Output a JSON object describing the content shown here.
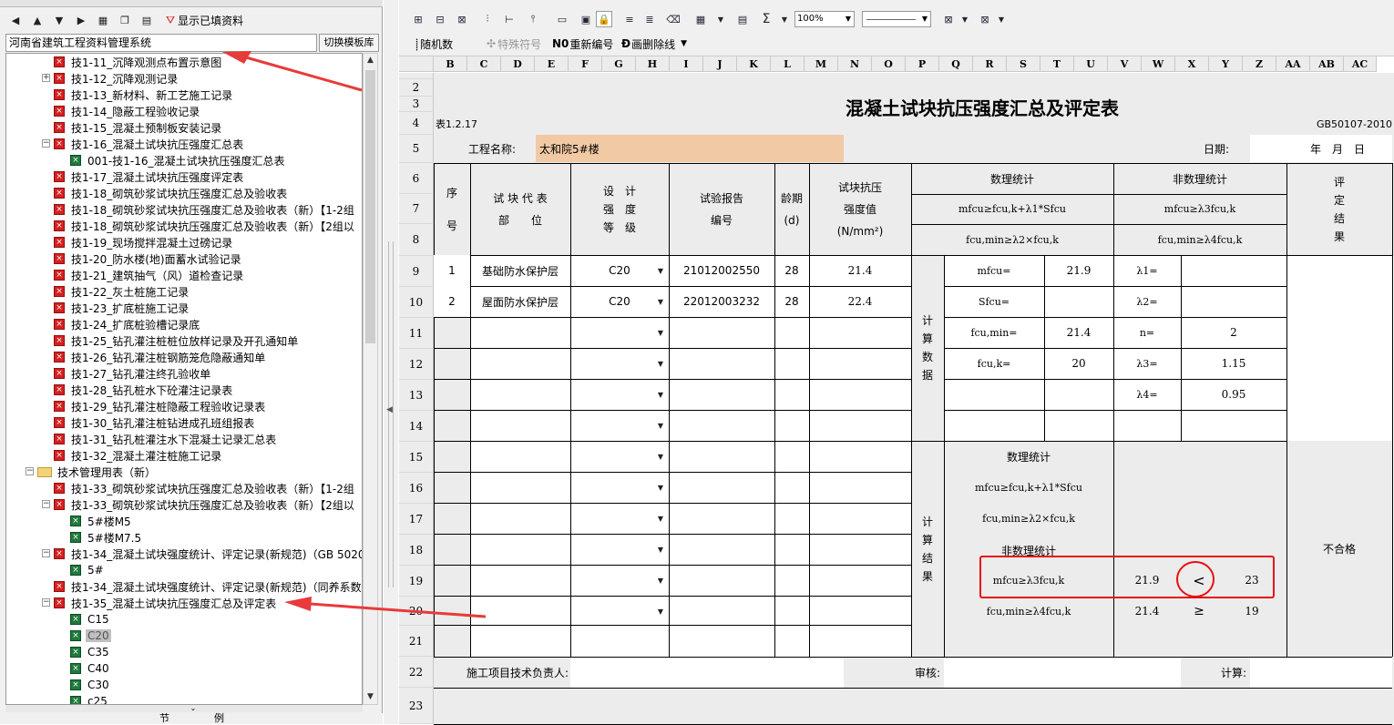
{
  "left_panel": {
    "toolbar": {
      "show_filled": "显示已填资料"
    },
    "project": "河南省建筑工程资料管理系统",
    "switch_template": "切换模板库",
    "tree": [
      {
        "label": "技1-11_沉降观测点布置示意图",
        "icon": "red",
        "level": 3,
        "exp": ""
      },
      {
        "label": "技1-12_沉降观测记录",
        "icon": "red",
        "level": 3,
        "exp": "+"
      },
      {
        "label": "技1-13_新材料、新工艺施工记录",
        "icon": "red",
        "level": 3,
        "exp": ""
      },
      {
        "label": "技1-14_隐蔽工程验收记录",
        "icon": "red",
        "level": 3,
        "exp": ""
      },
      {
        "label": "技1-15_混凝土预制板安装记录",
        "icon": "red",
        "level": 3,
        "exp": ""
      },
      {
        "label": "技1-16_混凝土试块抗压强度汇总表",
        "icon": "red",
        "level": 3,
        "exp": "-"
      },
      {
        "label": "001-技1-16_混凝土试块抗压强度汇总表",
        "icon": "green",
        "level": 4,
        "exp": ""
      },
      {
        "label": "技1-17_混凝土试块抗压强度评定表",
        "icon": "red",
        "level": 3,
        "exp": ""
      },
      {
        "label": "技1-18_砌筑砂浆试块抗压强度汇总及验收表",
        "icon": "red",
        "level": 3,
        "exp": ""
      },
      {
        "label": "技1-18_砌筑砂浆试块抗压强度汇总及验收表（新）【1-2组",
        "icon": "red",
        "level": 3,
        "exp": ""
      },
      {
        "label": "技1-18_砌筑砂浆试块抗压强度汇总及验收表（新）【2组以",
        "icon": "red",
        "level": 3,
        "exp": ""
      },
      {
        "label": "技1-19_现场搅拌混凝土过磅记录",
        "icon": "red",
        "level": 3,
        "exp": ""
      },
      {
        "label": "技1-20_防水楼(地)面蓄水试验记录",
        "icon": "red",
        "level": 3,
        "exp": ""
      },
      {
        "label": "技1-21_建筑抽气（风）道检查记录",
        "icon": "red",
        "level": 3,
        "exp": ""
      },
      {
        "label": "技1-22_灰土桩施工记录",
        "icon": "red",
        "level": 3,
        "exp": ""
      },
      {
        "label": "技1-23_扩底桩施工记录",
        "icon": "red",
        "level": 3,
        "exp": ""
      },
      {
        "label": "技1-24_扩底桩验槽记录底",
        "icon": "red",
        "level": 3,
        "exp": ""
      },
      {
        "label": "技1-25_钻孔灌注桩桩位放样记录及开孔通知单",
        "icon": "red",
        "level": 3,
        "exp": ""
      },
      {
        "label": "技1-26_钻孔灌注桩钢筋笼危隐蔽通知单",
        "icon": "red",
        "level": 3,
        "exp": ""
      },
      {
        "label": "技1-27_钻孔灌注终孔验收单",
        "icon": "red",
        "level": 3,
        "exp": ""
      },
      {
        "label": "技1-28_钻孔桩水下砼灌注记录表",
        "icon": "red",
        "level": 3,
        "exp": ""
      },
      {
        "label": "技1-29_钻孔灌注桩隐蔽工程验收记录表",
        "icon": "red",
        "level": 3,
        "exp": ""
      },
      {
        "label": "技1-30_钻孔灌注桩钻进成孔班组报表",
        "icon": "red",
        "level": 3,
        "exp": ""
      },
      {
        "label": "技1-31_钻孔桩灌注水下混凝土记录汇总表",
        "icon": "red",
        "level": 3,
        "exp": ""
      },
      {
        "label": "技1-32_混凝土灌注桩施工记录",
        "icon": "red",
        "level": 3,
        "exp": ""
      },
      {
        "label": "技术管理用表（新）",
        "icon": "folder",
        "level": 2,
        "exp": "-"
      },
      {
        "label": "技1-33_砌筑砂浆试块抗压强度汇总及验收表（新）【1-2组",
        "icon": "red",
        "level": 3,
        "exp": ""
      },
      {
        "label": "技1-33_砌筑砂浆试块抗压强度汇总及验收表（新）【2组以",
        "icon": "red",
        "level": 3,
        "exp": "-"
      },
      {
        "label": "5#楼M5",
        "icon": "green",
        "level": 4,
        "exp": ""
      },
      {
        "label": "5#楼M7.5",
        "icon": "green",
        "level": 4,
        "exp": ""
      },
      {
        "label": "技1-34_混凝土试块强度统计、评定记录(新规范)（GB 5020",
        "icon": "red",
        "level": 3,
        "exp": "-"
      },
      {
        "label": "5#",
        "icon": "green",
        "level": 4,
        "exp": ""
      },
      {
        "label": "技1-34_混凝土试块强度统计、评定记录(新规范)（同养系数",
        "icon": "red",
        "level": 3,
        "exp": ""
      },
      {
        "label": "技1-35_混凝土试块抗压强度汇总及评定表",
        "icon": "red",
        "level": 3,
        "exp": "-"
      },
      {
        "label": "C15",
        "icon": "green",
        "level": 4,
        "exp": ""
      },
      {
        "label": "C20",
        "icon": "green",
        "level": 4,
        "exp": "",
        "selected": true
      },
      {
        "label": "C35",
        "icon": "green",
        "level": 4,
        "exp": ""
      },
      {
        "label": "C40",
        "icon": "green",
        "level": 4,
        "exp": ""
      },
      {
        "label": "C30",
        "icon": "green",
        "level": 4,
        "exp": ""
      },
      {
        "label": "c25",
        "icon": "green",
        "level": 4,
        "exp": ""
      }
    ],
    "bottom_tabs": [
      "节",
      "例"
    ]
  },
  "toolbar2": {
    "random": "随机数",
    "special": "特殊符号",
    "renumber": "重新编号",
    "strike": "画删除线",
    "zoom": "100%"
  },
  "grid": {
    "cols": [
      "B",
      "C",
      "D",
      "E",
      "F",
      "G",
      "H",
      "I",
      "J",
      "K",
      "L",
      "M",
      "N",
      "O",
      "P",
      "Q",
      "R",
      "S",
      "T",
      "U",
      "V",
      "W",
      "X",
      "Y",
      "Z",
      "AA",
      "AB",
      "AC"
    ],
    "rows": [
      "2",
      "3",
      "4",
      "5",
      "6",
      "7",
      "8",
      "9",
      "10",
      "11",
      "12",
      "13",
      "14",
      "15",
      "16",
      "17",
      "18",
      "19",
      "20",
      "21",
      "22",
      "23"
    ]
  },
  "sheet": {
    "title": "混凝土试块抗压强度汇总及评定表",
    "table_no": "表1.2.17",
    "standard": "GB50107-2010",
    "project_label": "工程名称:",
    "project_name": "太和院5#楼",
    "date_label": "日期:",
    "date_value": "年　月　日",
    "h_seq": "序\n\n号",
    "h_part": "试 块 代 表\n部　　位",
    "h_grade": "设　计\n强　度\n等　级",
    "h_report": "试验报告\n编号",
    "h_age": "龄期\n(d)",
    "h_strength": "试块抗压\n强度值\n(N/mm²)",
    "h_stat": "数理统计",
    "h_nonstat": "非数理统计",
    "h_eval": "评\n定\n结\n果",
    "f_stat1": "mfcu≥fcu,k+λ1*Sfcu",
    "f_stat2": "fcu,min≥λ2×fcu,k",
    "f_non1": "mfcu≥λ3fcu,k",
    "f_non2": "fcu,min≥λ4fcu,k",
    "rows": [
      {
        "seq": "1",
        "part": "基础防水保护层",
        "grade": "C20",
        "report": "21012002550",
        "age": "28",
        "strength": "21.4"
      },
      {
        "seq": "2",
        "part": "屋面防水保护层",
        "grade": "C20",
        "report": "22012003232",
        "age": "28",
        "strength": "22.4"
      }
    ],
    "calc_data_label": "计\n算\n数\n据",
    "calc_result_label": "计\n算\n结\n果",
    "m_fcu": "mfcu=",
    "m_fcu_val": "21.9",
    "s_fcu": "Sfcu=",
    "f_min": "fcu,min=",
    "f_min_val": "21.4",
    "f_k": "fcu,k=",
    "f_k_val": "20",
    "lam1": "λ1=",
    "lam2": "λ2=",
    "n_label": "n=",
    "n_val": "2",
    "lam3": "λ3=",
    "lam3_val": "1.15",
    "lam4": "λ4=",
    "lam4_val": "0.95",
    "res_stat": "数理统计",
    "res_nonstat": "非数理统计",
    "res1_left": "21.9",
    "res1_op": "<",
    "res1_right": "23",
    "res2_left": "21.4",
    "res2_op": "≥",
    "res2_right": "19",
    "result": "不合格",
    "tech_lead": "施工项目技术负责人:",
    "review": "审核:",
    "calc": "计算:"
  }
}
